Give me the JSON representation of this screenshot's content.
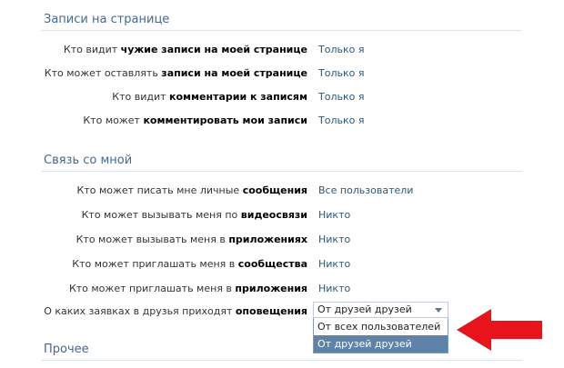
{
  "sections": {
    "posts": {
      "title": "Записи на странице",
      "rows": [
        {
          "prefix": "Кто видит ",
          "bold": "чужие записи на моей странице",
          "value": "Только я"
        },
        {
          "prefix": "Кто может оставлять ",
          "bold": "записи на моей странице",
          "value": "Только я"
        },
        {
          "prefix": "Кто видит ",
          "bold": "комментарии к записям",
          "value": "Только я"
        },
        {
          "prefix": "Кто может ",
          "bold": "комментировать мои записи",
          "value": "Только я"
        }
      ]
    },
    "contact": {
      "title": "Связь со мной",
      "rows": [
        {
          "prefix": "Кто может писать мне личные ",
          "bold": "сообщения",
          "value": "Все пользователи"
        },
        {
          "prefix": "Кто может вызывать меня по ",
          "bold": "видеосвязи",
          "value": "Никто"
        },
        {
          "prefix": "Кто может вызывать меня в ",
          "bold": "приложениях",
          "value": "Никто"
        },
        {
          "prefix": "Кто может приглашать меня в ",
          "bold": "сообщества",
          "value": "Никто"
        },
        {
          "prefix": "Кто может приглашать меня в ",
          "bold": "приложения",
          "value": "Никто"
        },
        {
          "prefix": "О каких заявках в друзья приходят ",
          "bold": "оповещения"
        }
      ],
      "notifications_dropdown": {
        "selected": "От друзей друзей",
        "options": [
          "От всех пользователей",
          "От друзей друзей"
        ],
        "highlighted_index": 1
      }
    },
    "other": {
      "title": "Прочее"
    }
  },
  "colors": {
    "link": "#2b587a",
    "section_title": "#45688e",
    "highlight": "#5e82a8",
    "annotation_arrow": "#e8131b"
  }
}
